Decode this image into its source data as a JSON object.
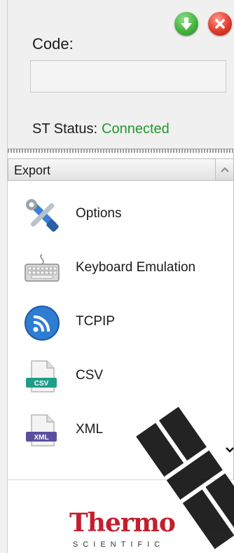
{
  "header": {
    "code_label": "Code:",
    "code_value": "",
    "status_label": "ST Status:",
    "status_value": "Connected"
  },
  "section": {
    "title": "Export"
  },
  "items": [
    {
      "label": "Options",
      "icon": "tools-icon"
    },
    {
      "label": "Keyboard Emulation",
      "icon": "keyboard-icon"
    },
    {
      "label": "TCPIP",
      "icon": "rss-icon"
    },
    {
      "label": "CSV",
      "icon": "csv-file-icon",
      "badge": "CSV"
    },
    {
      "label": "XML",
      "icon": "xml-file-icon",
      "badge": "XML"
    }
  ],
  "logo": {
    "main": "Thermo",
    "sub": "SCIENTIFIC"
  },
  "colors": {
    "status_connected": "#219a2b",
    "logo_red": "#c21f2d"
  }
}
